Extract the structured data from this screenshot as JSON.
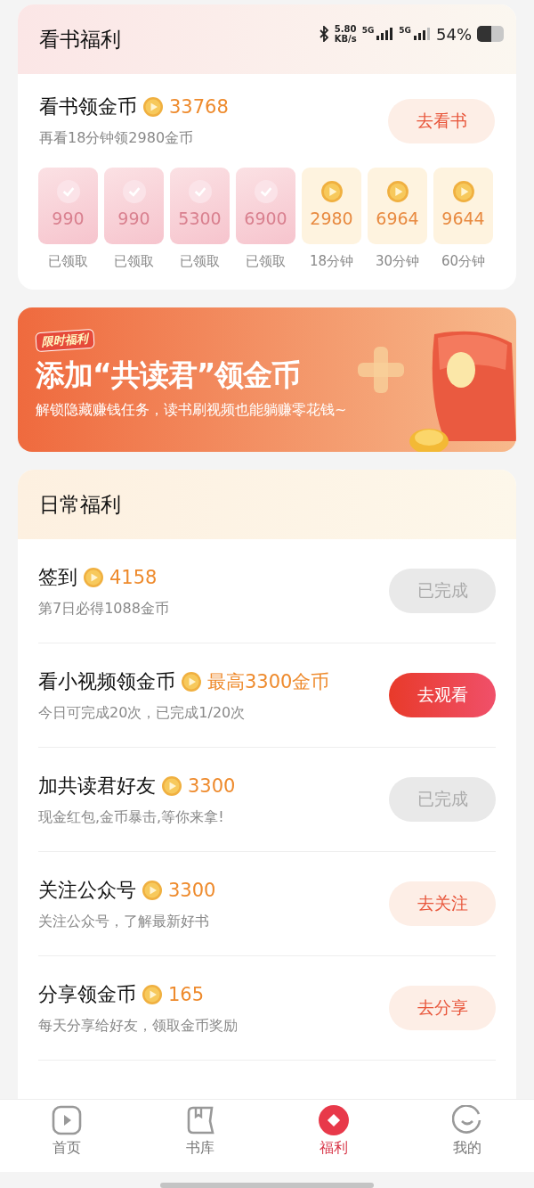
{
  "status_bar": {
    "speed": "5.80",
    "speed_unit": "KB/s",
    "network_1": "5G",
    "network_2": "5G",
    "battery": "54%"
  },
  "reading": {
    "title": "看书福利",
    "task": "看书领金币",
    "coins": "33768",
    "hint": "再看18分钟领2980金币",
    "button": "去看书",
    "rewards": [
      {
        "amount": "990",
        "label": "已领取",
        "claimed": true
      },
      {
        "amount": "990",
        "label": "已领取",
        "claimed": true
      },
      {
        "amount": "5300",
        "label": "已领取",
        "claimed": true
      },
      {
        "amount": "6900",
        "label": "已领取",
        "claimed": true
      },
      {
        "amount": "2980",
        "label": "18分钟",
        "claimed": false
      },
      {
        "amount": "6964",
        "label": "30分钟",
        "claimed": false
      },
      {
        "amount": "9644",
        "label": "60分钟",
        "claimed": false
      }
    ]
  },
  "banner": {
    "tag": "限时福利",
    "title": "添加“共读君”领金币",
    "subtitle": "解锁隐藏赚钱任务，读书刷视频也能躺赚零花钱~"
  },
  "daily": {
    "title": "日常福利",
    "tasks": [
      {
        "name": "签到",
        "coins": "4158",
        "desc": "第7日必得1088金币",
        "button": "已完成",
        "kind": "done"
      },
      {
        "name": "看小视频领金币",
        "coins": "最高3300金币",
        "desc": "今日可完成20次，已完成1/20次",
        "button": "去观看",
        "kind": "primary"
      },
      {
        "name": "加共读君好友",
        "coins": "3300",
        "desc": "现金红包,金币暴击,等你来拿!",
        "button": "已完成",
        "kind": "done"
      },
      {
        "name": "关注公众号",
        "coins": "3300",
        "desc": "关注公众号，了解最新好书",
        "button": "去关注",
        "kind": "light"
      },
      {
        "name": "分享领金币",
        "coins": "165",
        "desc": "每天分享给好友，领取金币奖励",
        "button": "去分享",
        "kind": "light"
      }
    ]
  },
  "tabs": [
    {
      "label": "首页",
      "selected": false,
      "kind": "home"
    },
    {
      "label": "书库",
      "selected": false,
      "kind": "library"
    },
    {
      "label": "福利",
      "selected": true,
      "kind": "welfare"
    },
    {
      "label": "我的",
      "selected": false,
      "kind": "me"
    }
  ]
}
